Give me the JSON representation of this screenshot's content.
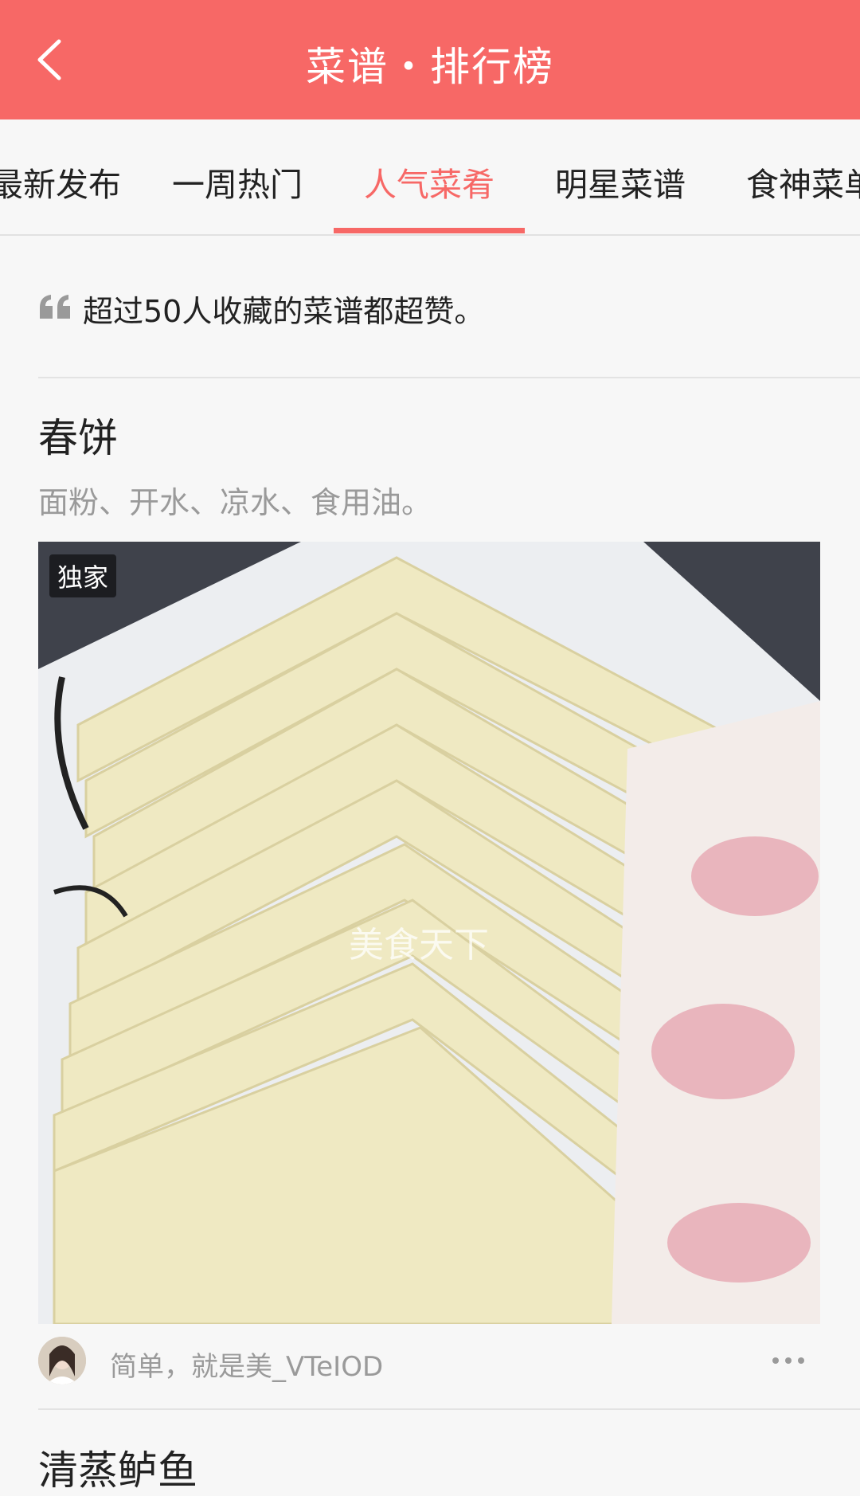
{
  "header": {
    "title": "菜谱・排行榜",
    "back_icon": "chevron-left-icon",
    "background_color": "#f76866"
  },
  "tabs": [
    {
      "label": "最新发布",
      "active": false
    },
    {
      "label": "一周热门",
      "active": false
    },
    {
      "label": "人气菜肴",
      "active": true
    },
    {
      "label": "明星菜谱",
      "active": false
    },
    {
      "label": "食神菜单",
      "active": false
    }
  ],
  "intro": {
    "icon": "quote-icon",
    "text": "超过50人收藏的菜谱都超赞。"
  },
  "recipes": [
    {
      "title": "春饼",
      "ingredients": "面粉、开水、凉水、食用油。",
      "badge": "独家",
      "image_watermark": "美食天下",
      "author": {
        "name": "简单，就是美_VTeIOD",
        "avatar_icon": "avatar"
      },
      "more_icon": "more-icon"
    },
    {
      "title": "清蒸鲈鱼"
    }
  ],
  "colors": {
    "accent": "#f76866",
    "text_primary": "#222222",
    "text_secondary": "#9a9a9a",
    "background": "#f7f7f7"
  }
}
